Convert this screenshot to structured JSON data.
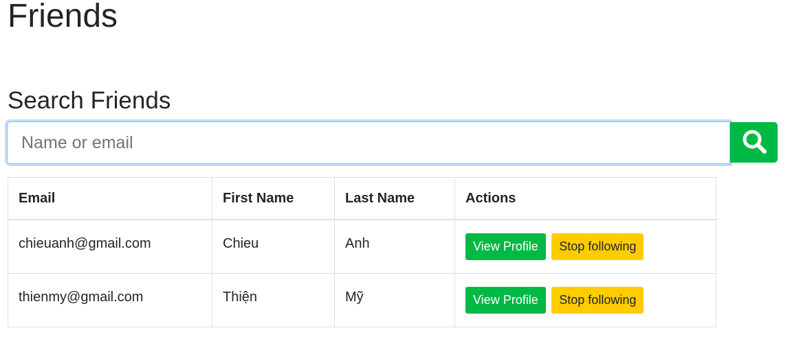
{
  "page": {
    "title": "Friends",
    "search_heading": "Search Friends"
  },
  "search": {
    "placeholder": "Name or email",
    "value": "",
    "button_icon": "search-icon"
  },
  "colors": {
    "primary_green": "#00b944",
    "warning_yellow": "#ffcc00",
    "focus_border": "#80bdff"
  },
  "table": {
    "headers": [
      "Email",
      "First Name",
      "Last Name",
      "Actions"
    ],
    "rows": [
      {
        "email": "chieuanh@gmail.com",
        "first_name": "Chieu",
        "last_name": "Anh",
        "view_label": "View Profile",
        "stop_label": "Stop following"
      },
      {
        "email": "thienmy@gmail.com",
        "first_name": "Thiện",
        "last_name": "Mỹ",
        "view_label": "View Profile",
        "stop_label": "Stop following"
      }
    ]
  }
}
